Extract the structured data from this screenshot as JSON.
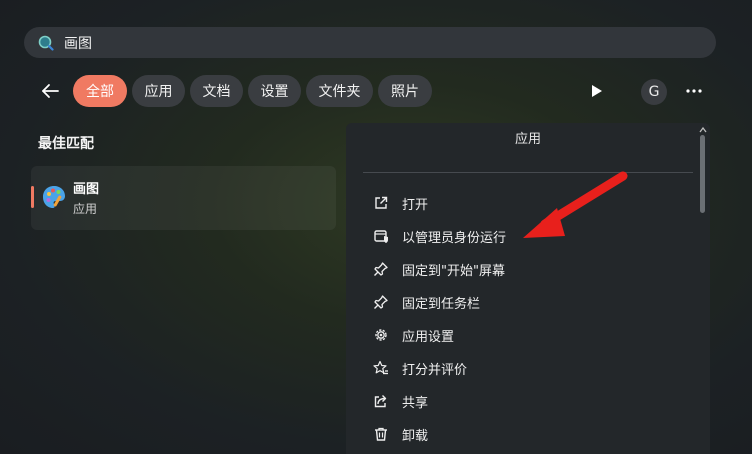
{
  "search": {
    "query": "画图",
    "icon": "search-icon"
  },
  "filters": {
    "back_icon": "arrow-left-icon",
    "chips": [
      {
        "label": "全部",
        "active": true
      },
      {
        "label": "应用",
        "active": false
      },
      {
        "label": "文档",
        "active": false
      },
      {
        "label": "设置",
        "active": false
      },
      {
        "label": "文件夹",
        "active": false
      },
      {
        "label": "照片",
        "active": false
      }
    ],
    "play_icon": "play-icon",
    "account_initial": "G",
    "more_icon": "more-icon"
  },
  "best_match": {
    "heading": "最佳匹配",
    "app_name": "画图",
    "app_type": "应用",
    "app_icon": "paint-palette-icon"
  },
  "details_pane": {
    "title": "应用",
    "actions": [
      {
        "label": "打开",
        "icon": "open-external-icon"
      },
      {
        "label": "以管理员身份运行",
        "icon": "admin-shield-icon"
      },
      {
        "label": "固定到\"开始\"屏幕",
        "icon": "pin-icon"
      },
      {
        "label": "固定到任务栏",
        "icon": "pin-icon"
      },
      {
        "label": "应用设置",
        "icon": "gear-icon"
      },
      {
        "label": "打分并评价",
        "icon": "star-rate-icon"
      },
      {
        "label": "共享",
        "icon": "share-icon"
      },
      {
        "label": "卸载",
        "icon": "trash-icon"
      }
    ]
  },
  "colors": {
    "accent": "#f07a62",
    "annotation_arrow": "#e8201c",
    "pane_bg": "#23272a",
    "chip_bg": "#3a3d41"
  }
}
